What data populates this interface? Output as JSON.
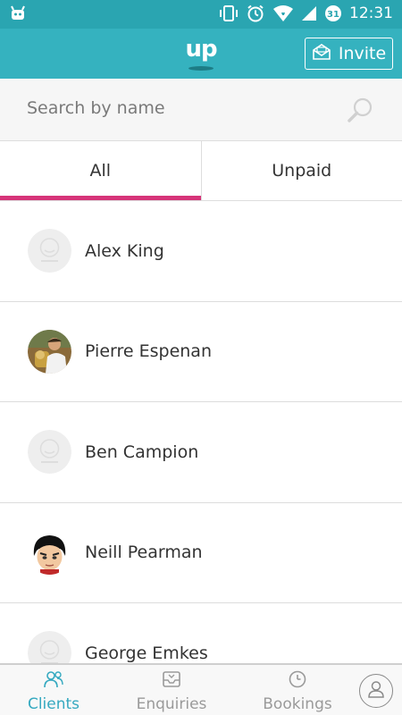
{
  "status_bar": {
    "time": "12:31",
    "calendar_day": "31",
    "icons": [
      "android-icon",
      "vibrate-icon",
      "alarm-icon",
      "wifi-icon",
      "signal-icon",
      "calendar-icon"
    ]
  },
  "app_bar": {
    "logo_text": "up",
    "invite_label": "Invite"
  },
  "search": {
    "placeholder": "Search by name"
  },
  "tabs": [
    {
      "label": "All",
      "selected": true
    },
    {
      "label": "Unpaid",
      "selected": false
    }
  ],
  "clients": [
    {
      "name": "Alex King",
      "avatar": "placeholder"
    },
    {
      "name": "Pierre Espenan",
      "avatar": "photo"
    },
    {
      "name": "Ben Campion",
      "avatar": "placeholder"
    },
    {
      "name": "Neill Pearman",
      "avatar": "cartoon"
    },
    {
      "name": "George Emkes",
      "avatar": "placeholder"
    }
  ],
  "bottom_nav": {
    "items": [
      {
        "label": "Clients",
        "icon": "people-icon",
        "active": true
      },
      {
        "label": "Enquiries",
        "icon": "inbox-icon",
        "active": false
      },
      {
        "label": "Bookings",
        "icon": "clock-icon",
        "active": false
      }
    ],
    "profile_icon": "user-icon"
  },
  "colors": {
    "status_bar": "#2aa5b1",
    "app_bar": "#35b2bf",
    "tab_indicator": "#d63479",
    "active_nav": "#35a9c0"
  }
}
